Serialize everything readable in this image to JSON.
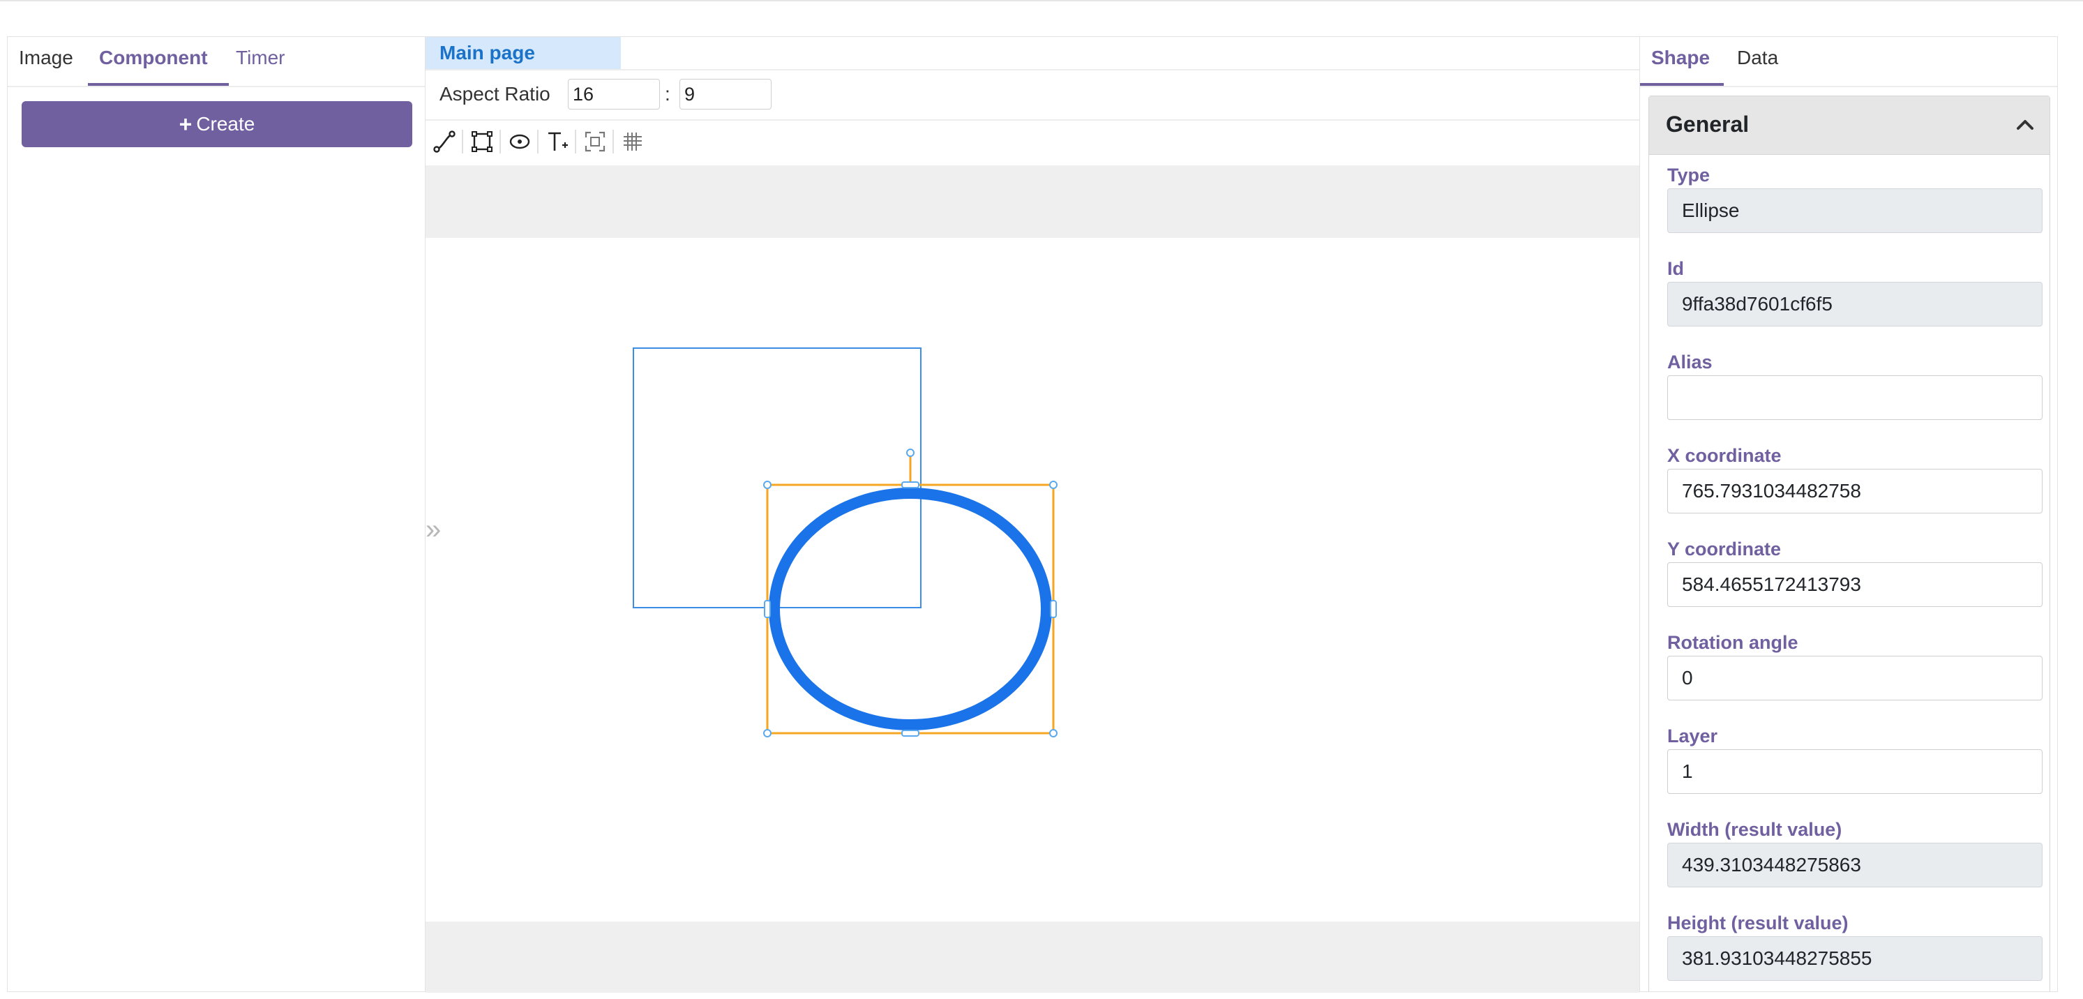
{
  "left_tabs": [
    "Image",
    "Component",
    "Timer"
  ],
  "create_label": "Create",
  "page_tab": "Main page",
  "aspect": {
    "label": "Aspect Ratio",
    "width": "16",
    "height": "9",
    "separator": ":"
  },
  "toolbar_icons": [
    "line-tool-icon",
    "rectangle-tool-icon",
    "ellipse-tool-icon",
    "text-tool-icon",
    "fit-screen-icon",
    "grid-icon"
  ],
  "expand_glyph": "»",
  "right_tabs": [
    "Shape",
    "Data"
  ],
  "panel": {
    "title": "General",
    "fields": [
      {
        "label": "Type",
        "value": "Ellipse",
        "readonly": true
      },
      {
        "label": "Id",
        "value": "9ffa38d7601cf6f5",
        "readonly": true
      },
      {
        "label": "Alias",
        "value": "",
        "readonly": false
      },
      {
        "label": "X coordinate",
        "value": "765.7931034482758",
        "readonly": false
      },
      {
        "label": "Y coordinate",
        "value": "584.4655172413793",
        "readonly": false
      },
      {
        "label": "Rotation angle",
        "value": "0",
        "readonly": false
      },
      {
        "label": "Layer",
        "value": "1",
        "readonly": false
      },
      {
        "label": "Width (result value)",
        "value": "439.3103448275863",
        "readonly": true
      },
      {
        "label": "Height (result value)",
        "value": "381.93103448275855",
        "readonly": true
      }
    ]
  },
  "colors": {
    "accent": "#7060a0",
    "page_tab_bg": "#d6e8fb",
    "selection": "#f5a623",
    "shape_blue": "#1a73e8",
    "rectangle_stroke": "#3c8de6"
  }
}
